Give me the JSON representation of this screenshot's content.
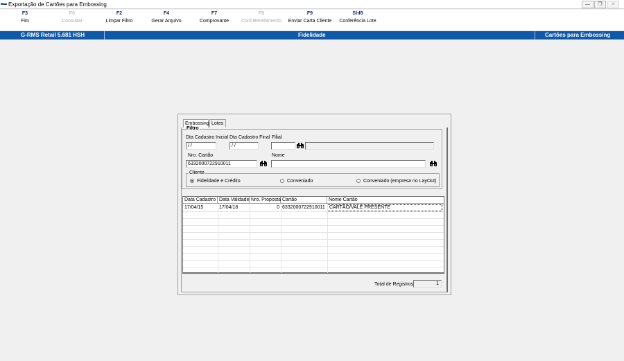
{
  "window": {
    "title": "Exportação de Cartões para Embossing",
    "controls": [
      "minimize",
      "maximize",
      "close"
    ]
  },
  "fkeys": [
    {
      "key": "F3",
      "label": "Fim",
      "enabled": true
    },
    {
      "key": "F6",
      "label": "Consultar",
      "enabled": false
    },
    {
      "key": "F2",
      "label": "Limpar Filtro",
      "enabled": true
    },
    {
      "key": "F4",
      "label": "Gerar Arquivo",
      "enabled": true
    },
    {
      "key": "F7",
      "label": "Comprovante",
      "enabled": true
    },
    {
      "key": "F8",
      "label": "Conf.Recebimento",
      "enabled": false
    },
    {
      "key": "F9",
      "label": "Enviar Carta Cliente",
      "enabled": true
    },
    {
      "key": "Shf8",
      "label": "Conferência Lote",
      "enabled": true
    }
  ],
  "statusbar": {
    "left": "G-RMS Retail 5.681 HSH",
    "center": "Fidelidade",
    "right": "Cartões para Embossing",
    "color": "#0f5aa8"
  },
  "tabs": [
    {
      "label": "Embossing",
      "active": true
    },
    {
      "label": "Lotes",
      "active": false
    }
  ],
  "filtro": {
    "group_label": "Filtro",
    "dta_inicial_label": "Dta Cadastro Inicial",
    "dta_inicial_value": " / /",
    "dta_final_label": "Dta Cadastro Final",
    "dta_final_value": " / /",
    "filial_label": "Filial",
    "filial_value": "",
    "filial_desc": "",
    "nro_cartao_label": "Nro. Cartão",
    "nro_cartao_value": "6332000722910011",
    "nome_label": "Nome",
    "nome_value": "",
    "cliente_label": "Cliente",
    "cliente_options": [
      {
        "label": "Fidelidade e Crédito",
        "selected": true
      },
      {
        "label": "Conveniado",
        "selected": false
      },
      {
        "label": "Conveniado (empresa no LayOut)",
        "selected": false
      }
    ]
  },
  "grid": {
    "columns": [
      "Data Cadastro",
      "Data Validade",
      "Nro. Proposta",
      "Cartão",
      "Nome Cartão"
    ],
    "rows": [
      [
        "17/04/15",
        "17/04/18",
        "0",
        "6332000722910011",
        "CARTÃO/VALE PRESENTE"
      ]
    ]
  },
  "total": {
    "label": "Total de Registros:",
    "value": "1"
  },
  "icons": [
    "app-icon",
    "binoculars-icon"
  ]
}
